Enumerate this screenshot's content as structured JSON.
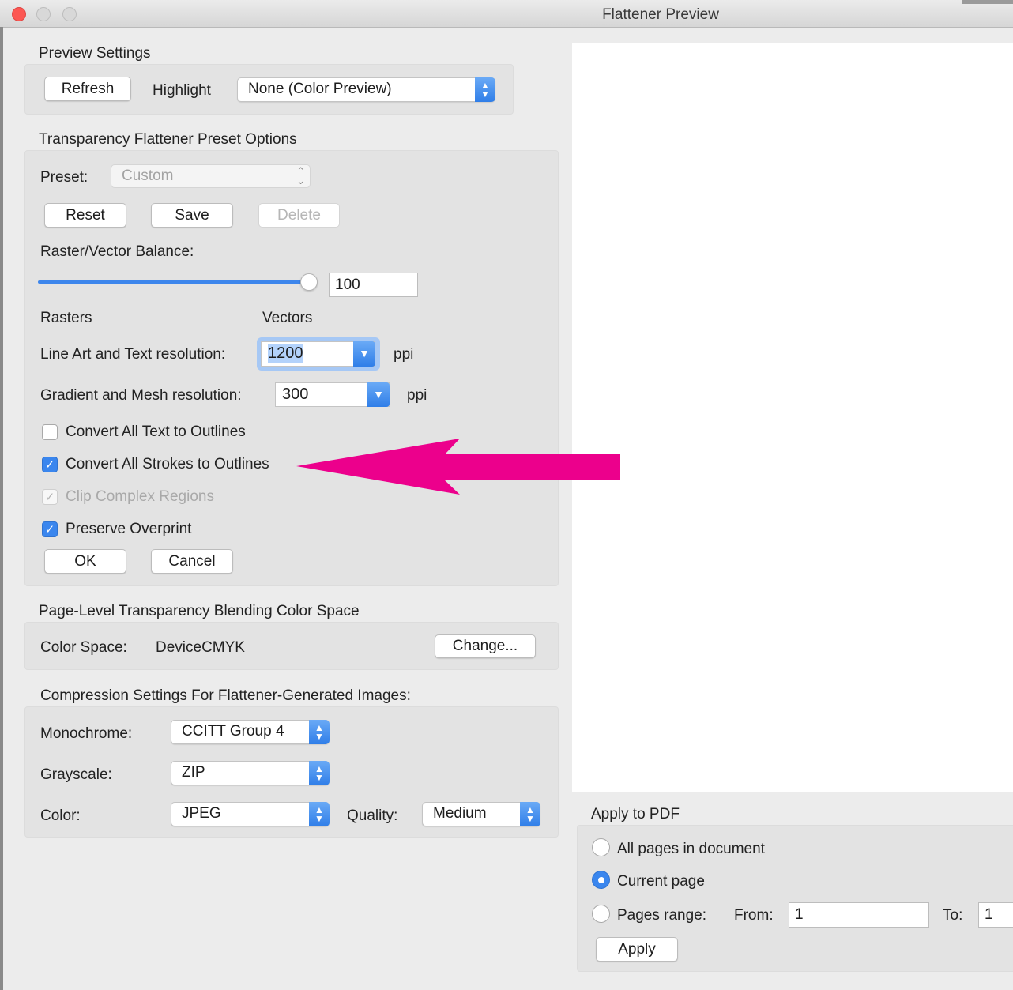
{
  "window": {
    "title": "Flattener Preview"
  },
  "preview_settings": {
    "section_title": "Preview Settings",
    "refresh_label": "Refresh",
    "highlight_label": "Highlight",
    "highlight_value": "None (Color Preview)"
  },
  "preset_options": {
    "section_title": "Transparency Flattener Preset Options",
    "preset_label": "Preset:",
    "preset_value": "Custom",
    "reset_label": "Reset",
    "save_label": "Save",
    "delete_label": "Delete",
    "balance_label": "Raster/Vector Balance:",
    "balance_value": "100",
    "balance_fraction": 1.0,
    "rasters_label": "Rasters",
    "vectors_label": "Vectors",
    "line_art_label": "Line Art and Text resolution:",
    "line_art_value": "1200",
    "gradient_label": "Gradient and Mesh resolution:",
    "gradient_value": "300",
    "ppi_unit": "ppi",
    "checkboxes": {
      "convert_text": {
        "label": "Convert All Text to Outlines",
        "checked": false
      },
      "convert_strokes": {
        "label": "Convert All Strokes to Outlines",
        "checked": true
      },
      "clip_complex": {
        "label": "Clip Complex Regions",
        "checked": true,
        "disabled": true
      },
      "preserve_overprint": {
        "label": "Preserve Overprint",
        "checked": true
      }
    },
    "ok_label": "OK",
    "cancel_label": "Cancel"
  },
  "color_space": {
    "section_title": "Page-Level Transparency Blending Color Space",
    "label": "Color Space:",
    "value": "DeviceCMYK",
    "change_label": "Change..."
  },
  "compression": {
    "section_title": "Compression Settings For Flattener-Generated Images:",
    "monochrome_label": "Monochrome:",
    "monochrome_value": "CCITT Group 4",
    "grayscale_label": "Grayscale:",
    "grayscale_value": "ZIP",
    "color_label": "Color:",
    "color_value": "JPEG",
    "quality_label": "Quality:",
    "quality_value": "Medium"
  },
  "apply_to_pdf": {
    "section_title": "Apply to PDF",
    "all_pages_label": "All pages in document",
    "current_page_label": "Current page",
    "pages_range_label": "Pages range:",
    "selected_option": "Current page",
    "from_label": "From:",
    "from_value": "1",
    "to_label": "To:",
    "to_value": "1",
    "apply_label": "Apply"
  },
  "colors": {
    "accent": "#3a86ee",
    "annotation_arrow": "#ec008c",
    "close_button": "#fc5753"
  }
}
